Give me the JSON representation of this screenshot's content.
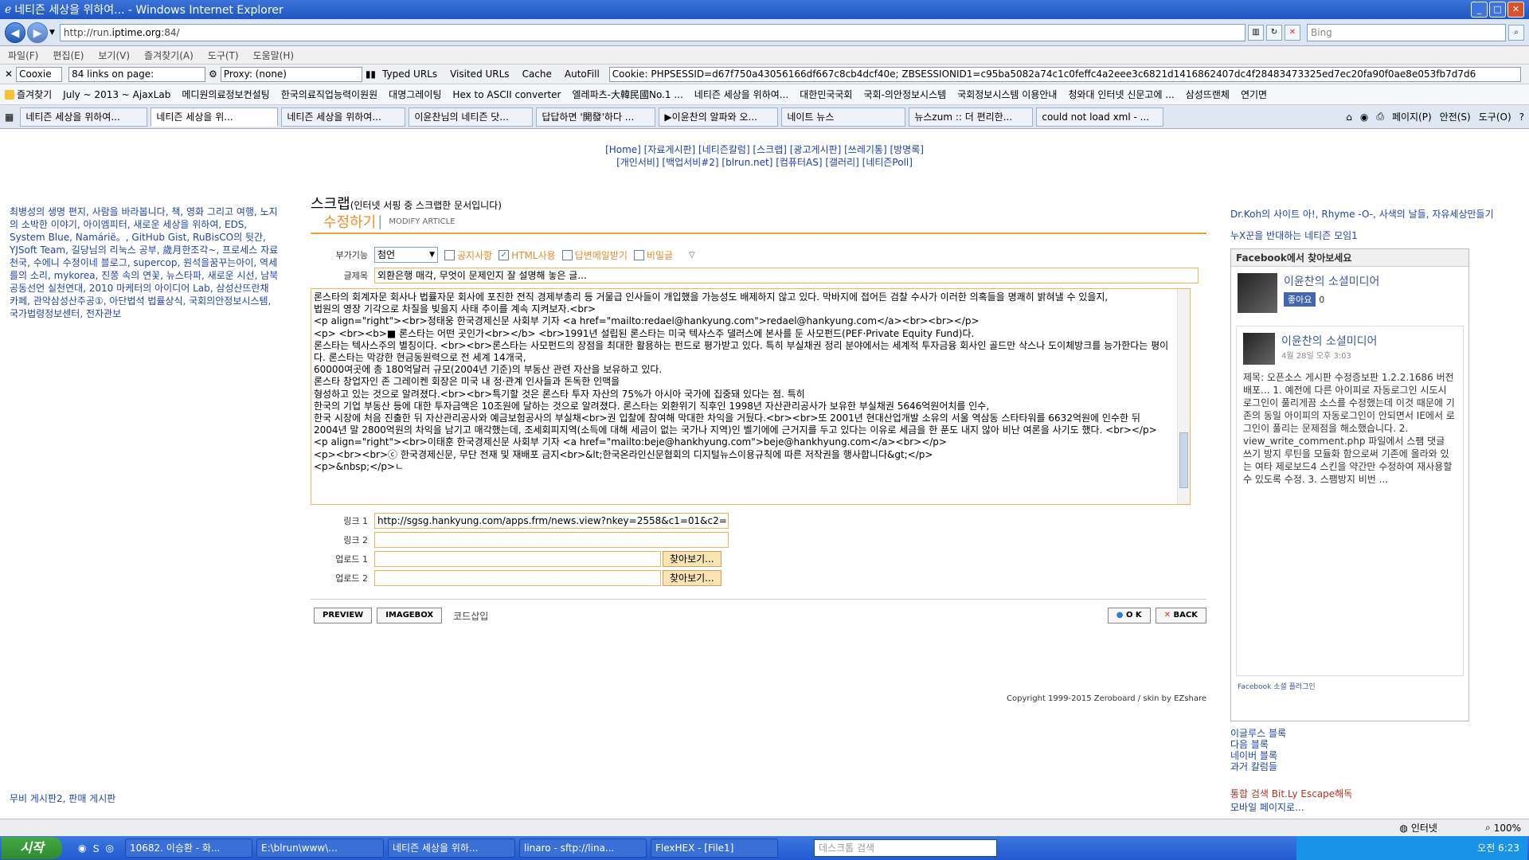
{
  "window": {
    "title": "네티즌 세상을 위하여... - Windows Internet Explorer"
  },
  "address": {
    "url_prefix": "http://run.",
    "url_domain": "iptime.org",
    "url_suffix": ":84/",
    "search_placeholder": "Bing"
  },
  "menu": [
    "파일(F)",
    "편집(E)",
    "보기(V)",
    "즐겨찾기(A)",
    "도구(T)",
    "도움말(H)"
  ],
  "toolbar": {
    "cookie": "Cooxie",
    "links": "84 links on page:",
    "proxy": "Proxy: (none)",
    "typed_urls": "Typed URLs",
    "visited_urls": "Visited URLs",
    "cache": "Cache",
    "autofill": "AutoFill",
    "cookie_value": "Cookie: PHPSESSID=d67f750a43056166df667c8cb4dcf40e; ZBSESSIONID1=c95ba5082a74c1c0feffc4a2eee3c6821d1416862407dc4f28483473325ed7ec20fa90f0ae8e053fb7d7d6"
  },
  "favorites": {
    "label": "즐겨찾기",
    "items": [
      "July ~ 2013 ~ AjaxLab",
      "메디원의료정보컨설팅",
      "한국의료직업능력이원원",
      "대명그레이팅",
      "Hex to ASCII converter",
      "엘레파츠-大韓民國No.1 ...",
      "네티즌 세상을 위하여...",
      "대한민국국회",
      "국회-의안정보시스템",
      "국회정보시스템 이용안내",
      "청와대 인터넷 신문고에 ...",
      "삼성뜨랜체",
      "연기면"
    ]
  },
  "tabs": [
    "네티즌 세상을 위하여...",
    "네티즌 세상을 위...",
    "네티즌 세상을 위하여...",
    "이윤찬님의 네티즌 닷...",
    "답답하면 '開發'하다 ...",
    "▶이윤찬의 알파와 오...",
    "네이트 뉴스",
    "뉴스zum :: 더 편리한...",
    "could not load xml - ..."
  ],
  "tab_tools": {
    "page": "페이지(P)",
    "safety": "안전(S)",
    "tools": "도구(O)"
  },
  "toplinks": {
    "line1": "[Home] [자료게시판] [네티즌칼럼] [스크랩] [광고게시판] [쓰레기통] [방명록]",
    "line2": "[개인서비] [백업서비#2] [blrun.net] [컴퓨터AS] [갤러리] [네티즌Poll]"
  },
  "left": {
    "links": "최병성의 생명 편지, 사람을 바라봅니다, 책, 영화 그리고 여행, 노지의 소박한 이야기, 아이엠피터, 새로운 세상을 위하여, EDS, System Blue, Namárië。, GitHub Gist, RuBisCO의 뒷간, YJSoft Team, 길당님의 리눅스 공부, 歲月한조각~, 프로세스 자료천국, 수에니 수정이네 블로그, supercop, 원석을꿈꾸는아이, 역세를의 소리, mykorea, 진쫑 속의 연꽃, 뉴스타파, 새로운 시선, 남북공동선언 실천연대, 2010 마케터의 아이디어 Lab, 삼성산뜨란채 카페, 관악삼성산주공①, 아단법석 법률상식, 국회의안정보시스템, 국가법령정보센터, 전자관보",
    "bottom": "무비 게시판2, 판매 게시판"
  },
  "main": {
    "scrap_title": "스크랩",
    "scrap_sub": "(인터넷 서핑 중 스크랩한 문서입니다)",
    "modify_title": "수정하기",
    "modify_sub": "MODIFY ARTICLE",
    "option_label": "부가기능",
    "option_value": "첨언",
    "chk_notice": "공지사항",
    "chk_html": "HTML사용",
    "chk_reply": "답변메일받기",
    "chk_secret": "비밀글",
    "subject_label": "글제목",
    "subject_value": "외환은행 매각, 무엇이 문제인지 잘 설명해 놓은 글...",
    "body_lines": [
      "론스타의 회계자문 회사나 법률자문 회사에 포진한 전직 경제부총리 등 거물급 인사들이 개입했을 가능성도 배제하지 않고 있다. 막바지에 접어든 검찰 수사가 이러한 의혹들을 명쾌히 밝혀낼 수 있을지,",
      "법원의 영장 기각으로 차질을 빚을지 사태 추이를 계속 지켜보자.<br>",
      "<p align=\"right\"><br>정태웅 한국경제신문 사회부 기자 <a href=\"mailto:redael@hankyung.com\">redael@hankyung.com</a><br><br></p>",
      "<p> <br><b>■ 론스타는 어떤 곳인가<br></b> <br>1991년 설립된 론스타는 미국 텍사스주 댈러스에 본사를 둔 사모펀드(PEF·Private Equity Fund)다.",
      "론스타는 텍사스주의 별칭이다. <br><br>론스타는 사모펀드의 장점을 최대한 활용하는 펀드로 평가받고 있다. 특히 부실채권 정리 분야에서는 세계적 투자금융 회사인 골드만 삭스나 도이체방크를 능가한다는 평이다. 론스타는 막강한 현금동원력으로 전 세계 14개국,",
      "60000여곳에 총 180억달러 규모(2004년 기준)의 부동산 관련 자산을 보유하고 있다.",
      "론스타 창업자인 존 그레이켄 회장은 미국 내 정·관계 인사들과 돈독한 인맥을",
      "형성하고 있는 것으로 알려졌다.<br><br>특기할 것은 론스타 투자 자산의 75%가 아시아 국가에 집중돼 있다는 점. 특히",
      "한국의 기업 부동산 등에 대한 투자금액은 10조원에 달하는 것으로 알려졌다. 론스타는 외환위기 직후인 1998년 자산관리공사가 보유한 부실채권 5646억원어치를 인수,",
      "한국 시장에 처음 진출한 뒤 자산관리공사와 예금보험공사의 부실채<br>권 입찰에 참여해 막대한 차익을 거뒀다.<br><br>또 2001년 현대산업개발 소유의 서울 역삼동 스타타워를 6632억원에 인수한 뒤",
      "2004년 말 2800억원의 차익을 남기고 매각했는데, 조세회피지역(소득에 대해 세금이 없는 국가나 지역)인 벨기에에 근거지를 두고 있다는 이유로 세금을 한 푼도 내지 않아 비난 여론을 사기도 했다. <br></p>",
      "<p align=\"right\"><br>이태훈 한국경제신문 사회부 기자 <a href=\"mailto:beje@hankhyung.com\">beje@hankhyung.com</a><br></p>",
      "<p><br><br>ⓒ 한국경제신문, 무단 전재 및 재배포 금지<br>&lt;한국온라인신문협회의 디지털뉴스이용규칙에 따른 저작권을 행사합니다&gt;</p>",
      "<p>&nbsp;</p>ㄴ"
    ],
    "link1_label": "링크 1",
    "link1_value": "http://sgsg.hankyung.com/apps.frm/news.view?nkey=2558&c1=01&c2=",
    "link2_label": "링크 2",
    "upload1_label": "업로드 1",
    "upload2_label": "업로드 2",
    "browse": "찾아보기...",
    "preview": "PREVIEW",
    "imagebox": "IMAGEBOX",
    "code_insert": "코드삽입",
    "ok": "O K",
    "back": "BACK",
    "copyright": "Copyright 1999-2015 Zeroboard / skin by EZshare"
  },
  "right": {
    "top_links": "Dr.Koh의 사이트 아!, Rhyme -O-, 사색의 날들, 자유세상만들기",
    "group": "누X꾼을 반대하는 네티즌 모임1",
    "fb_header": "Facebook에서 찾아보세요",
    "fb_page": "이윤찬의 소셜미디어",
    "fb_like": "좋아요",
    "fb_like_count": "0",
    "fb_post_name": "이윤찬의 소셜미디어",
    "fb_post_date": "4월 28일 오후 3:03",
    "fb_post_text": "제목: 오픈소스 게시판 수정증보판 1.2.2.1686 버전 배포... 1. 예전에 다른 아이피로 자동로그인 시도시 로그인이 풀리게끔 소스를 수정했는데 이것 때문에 기존의 동일 아이피의 자동로그인이 안되면서 IE에서 로그인이 풀리는 문제점을 해소했습니다. 2. view_write_comment.php 파일에서 스팸 댓글 쓰기 방지 루틴을 모듈화 함으로써 기존에 올라와 있는 여타 제로보드4 스킨을 약간만 수정하여 재사용할 수 있도록 수정. 3. 스팸방지 비번 ...",
    "fb_footer": "Facebook 소셜 플러그인",
    "links": [
      "이글루스 블록",
      "다음 블록",
      "네이버 블록",
      "과거 칼럼들"
    ],
    "search": "통합 검색 Bit.Ly Escape해독",
    "mobile": "모바일 페이지로..."
  },
  "status": {
    "zone": "인터넷",
    "zoom": "100%"
  },
  "taskbar": {
    "start": "시작",
    "tasks": [
      "10682. 이승환 - 화...",
      "E:\\blrun\\www\\...",
      "네티즌 세상을 위하...",
      "linaro - sftp://lina...",
      "FlexHEX - [File1]"
    ],
    "desktop_search": "데스크톱 검색",
    "clock": "오전 6:23"
  },
  "colors": {
    "accent": "#f08f22",
    "link": "#2244aa",
    "fb": "#3b5998"
  }
}
